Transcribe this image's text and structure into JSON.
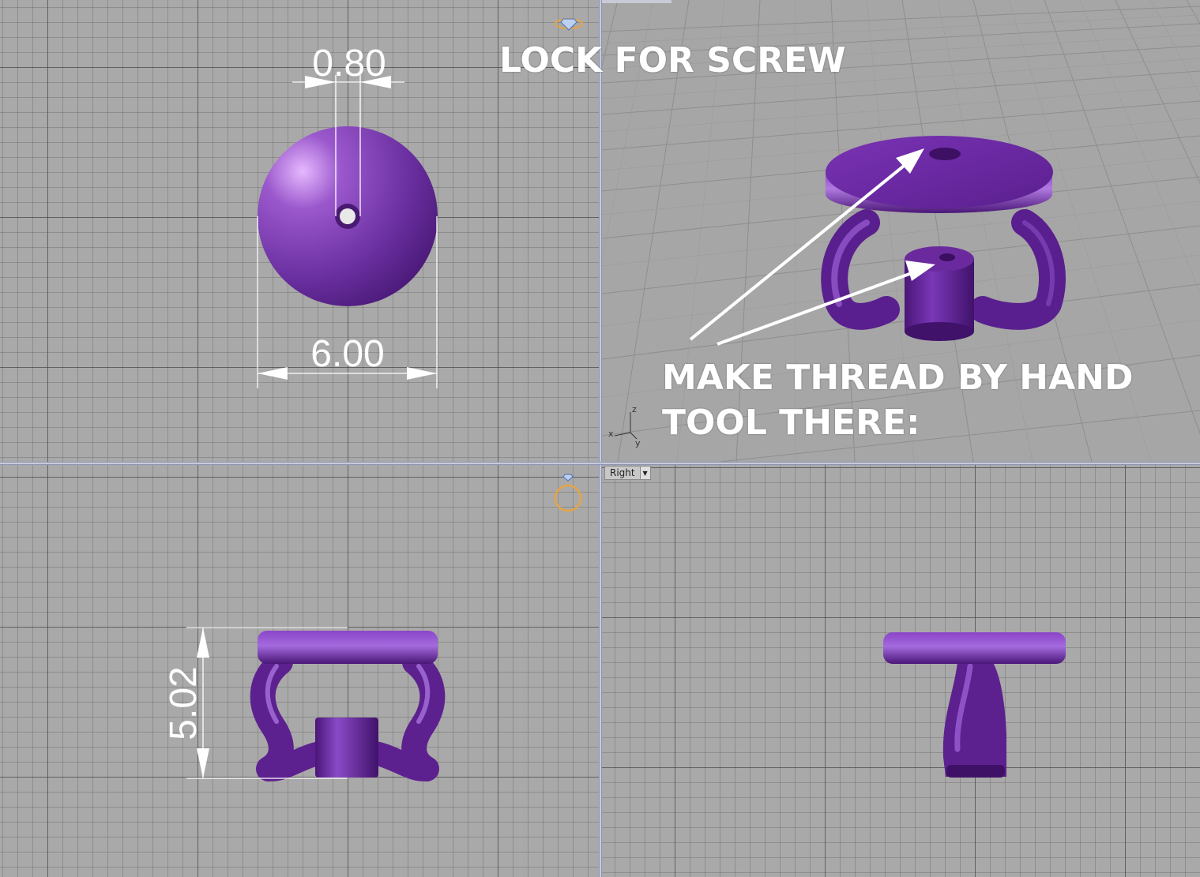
{
  "annotations": {
    "title": "LOCK FOR SCREW",
    "thread_line1": "MAKE THREAD BY HAND",
    "thread_line2": "TOOL THERE:"
  },
  "dimensions": {
    "hole_diameter": "0.80",
    "disc_diameter": "6.00",
    "height": "5.02"
  },
  "viewport_labels": {
    "right": "Right"
  },
  "axes": {
    "x": "x",
    "y": "y",
    "z": "z"
  },
  "icons": [
    "gem-icon",
    "ring-icon",
    "dropdown-arrow-icon"
  ],
  "colors": {
    "model": "#6a2fa3",
    "grid_bg": "#a9a9a9",
    "annotation": "#ffffff"
  }
}
